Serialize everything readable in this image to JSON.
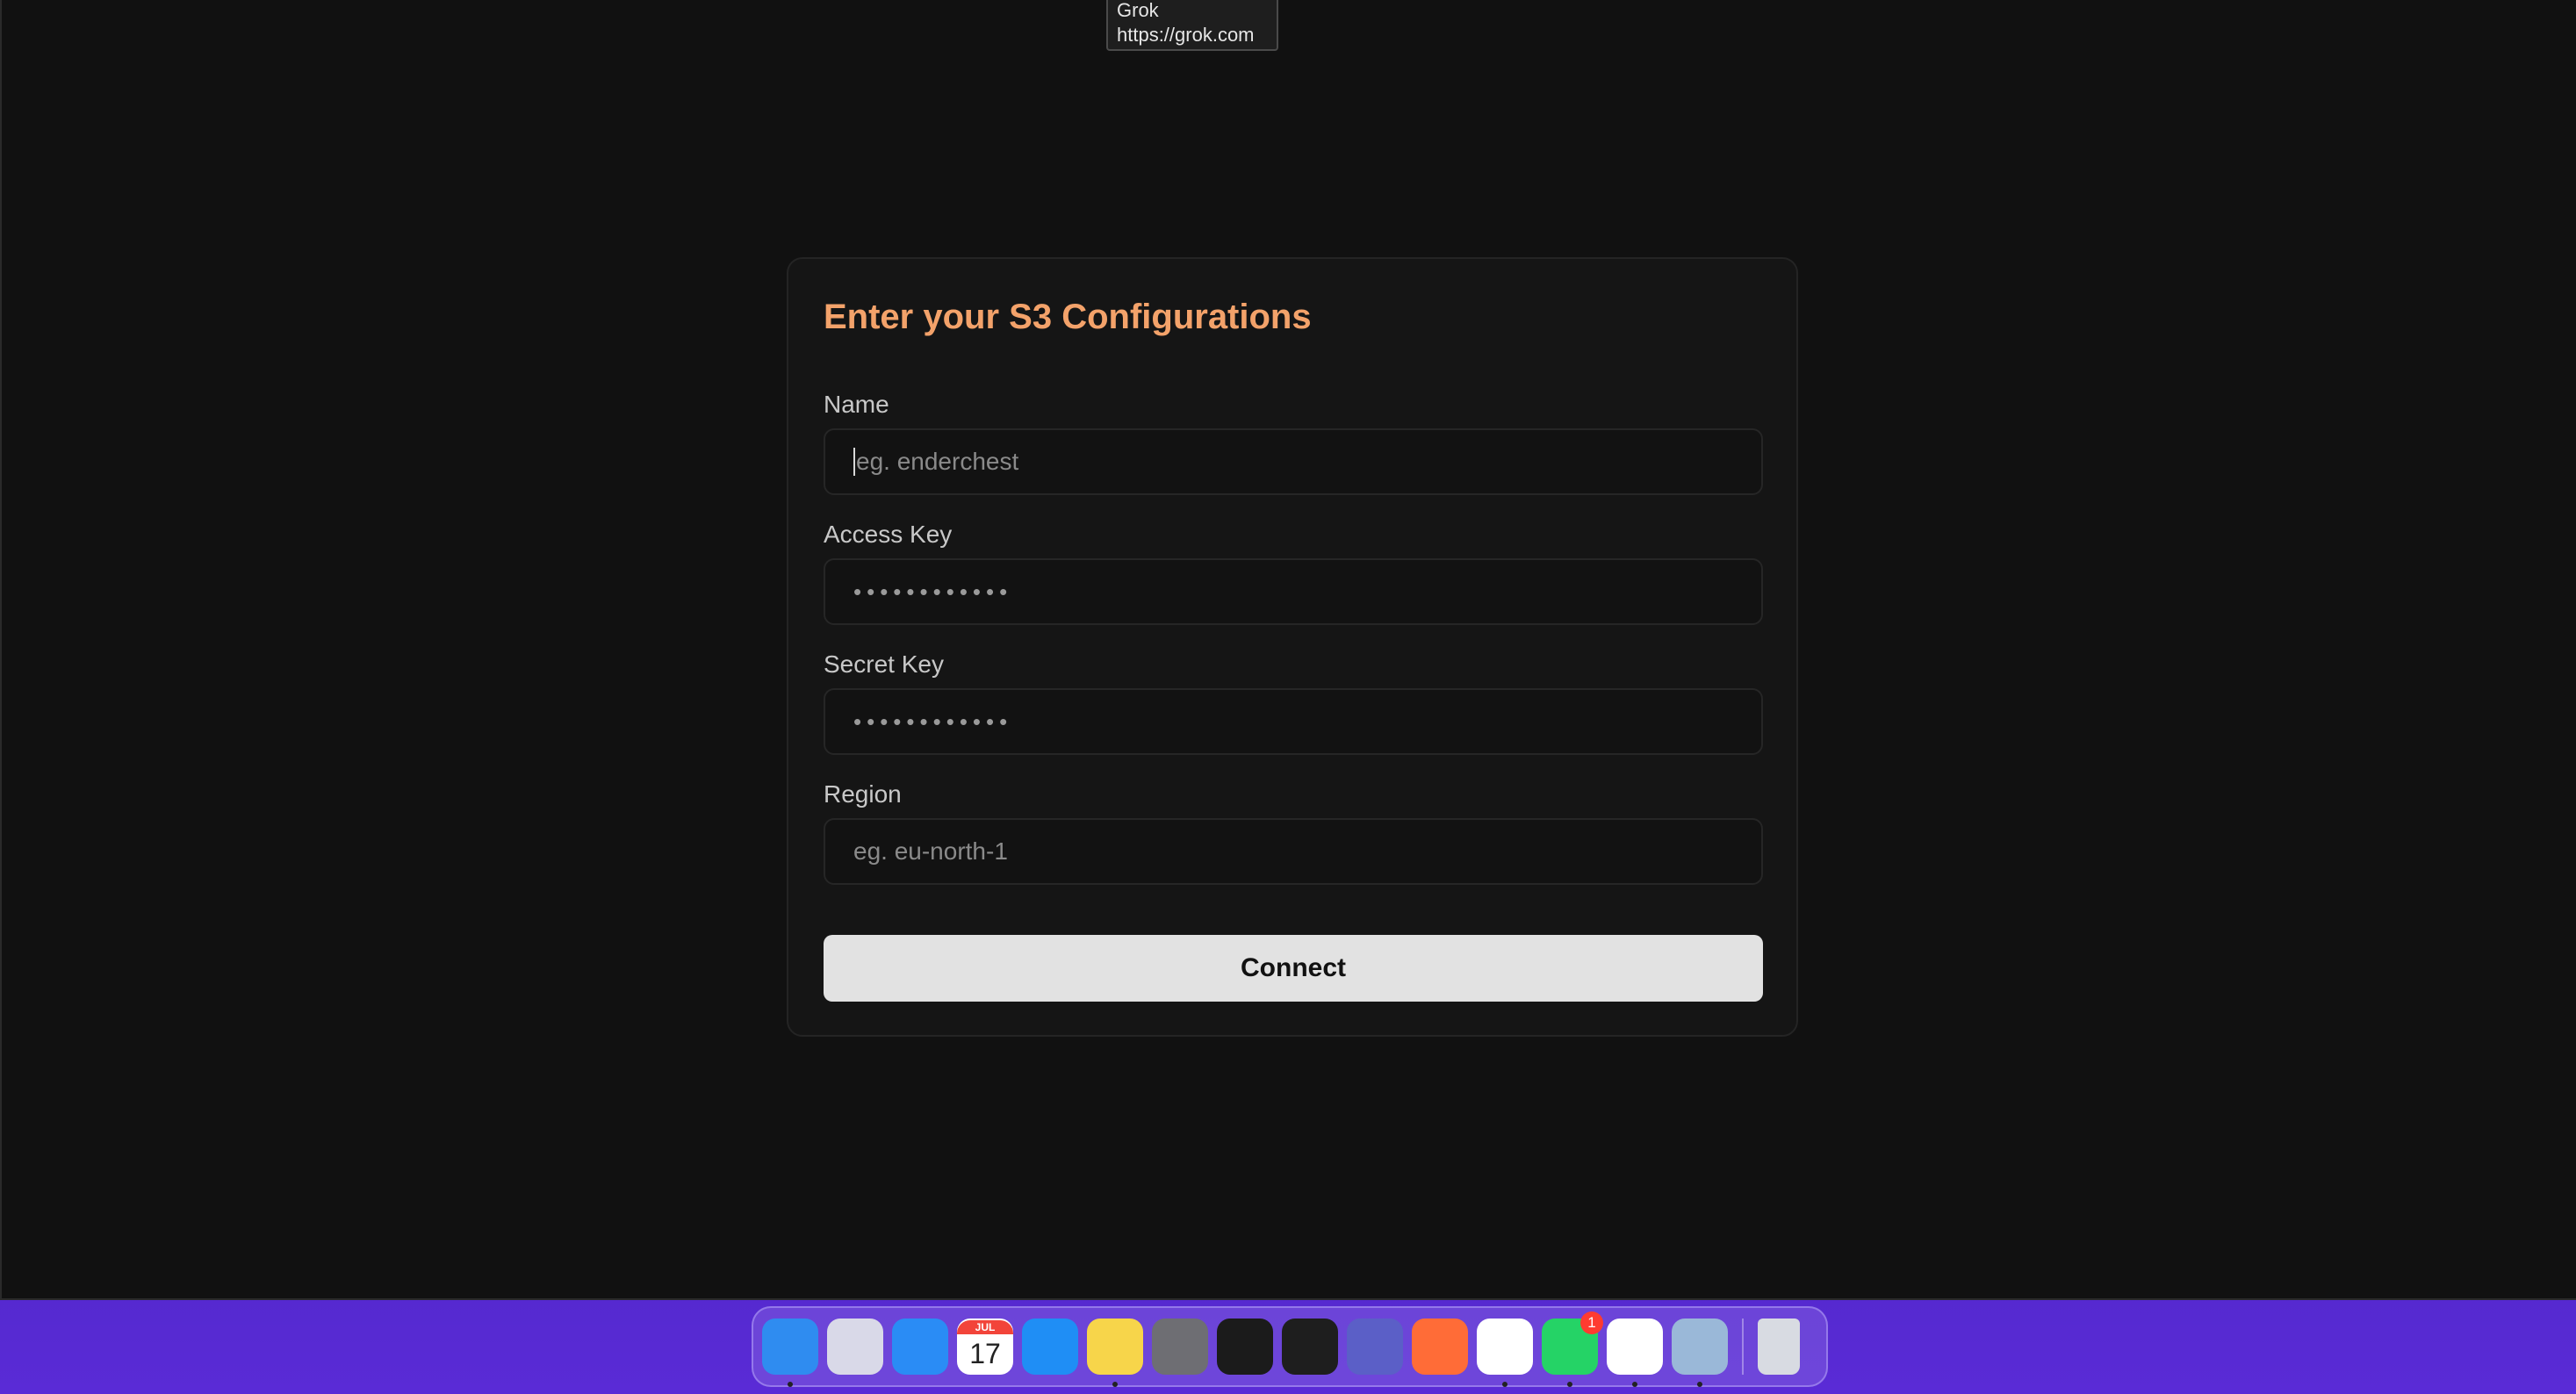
{
  "tooltip": {
    "title": "Grok",
    "url": "https://grok.com"
  },
  "form": {
    "title": "Enter your S3 Configurations",
    "fields": [
      {
        "label": "Name",
        "placeholder": "eg. enderchest",
        "value": ""
      },
      {
        "label": "Access Key",
        "value": "••••••••••••"
      },
      {
        "label": "Secret Key",
        "value": "••••••••••••"
      },
      {
        "label": "Region",
        "placeholder": "eg. eu-north-1",
        "value": ""
      }
    ],
    "submit_label": "Connect"
  },
  "dock": {
    "apps": [
      {
        "name": "finder-icon",
        "color": "#2f8cf0",
        "running": true
      },
      {
        "name": "launchpad-icon",
        "color": "#d9d9e8",
        "running": false
      },
      {
        "name": "safari-icon",
        "color": "#2a8cf5",
        "running": false
      },
      {
        "name": "calendar-icon",
        "color": "#ffffff",
        "running": false,
        "label_month": "JUL",
        "label_day": "17"
      },
      {
        "name": "app-store-icon",
        "color": "#1f8ef5",
        "running": false
      },
      {
        "name": "notes-icon",
        "color": "#f7d54a",
        "running": true
      },
      {
        "name": "system-settings-icon",
        "color": "#6e6e73",
        "running": false
      },
      {
        "name": "terminal-icon",
        "color": "#1b1b1b",
        "running": false
      },
      {
        "name": "figma-icon",
        "color": "#1e1e1e",
        "running": false
      },
      {
        "name": "teams-icon",
        "color": "#5b5fc7",
        "running": false
      },
      {
        "name": "postman-icon",
        "color": "#ff6c37",
        "running": false
      },
      {
        "name": "chrome-icon",
        "color": "#ffffff",
        "running": true
      },
      {
        "name": "whatsapp-icon",
        "color": "#25d366",
        "running": true,
        "badge": "1"
      },
      {
        "name": "vscode-icon",
        "color": "#ffffff",
        "running": true
      },
      {
        "name": "preview-icon",
        "color": "#9ab8d8",
        "running": true
      }
    ],
    "trash": {
      "name": "trash-icon",
      "color": "#d8dbe2"
    }
  }
}
